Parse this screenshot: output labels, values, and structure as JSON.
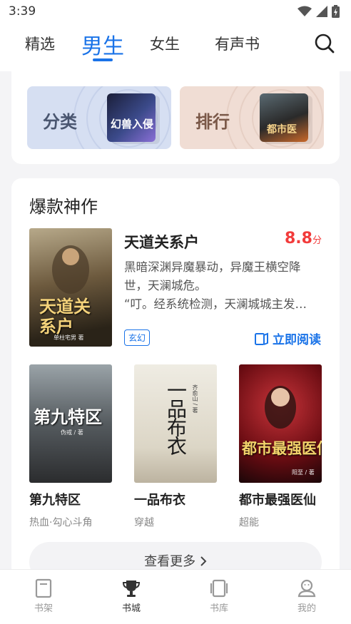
{
  "status": {
    "time": "3:39"
  },
  "nav": {
    "tabs": [
      {
        "label": "精选"
      },
      {
        "label": "男生"
      },
      {
        "label": "女生"
      },
      {
        "label": "有声书"
      }
    ]
  },
  "quick_entries": {
    "category_label": "分类",
    "category_cover_text": "幻兽入侵",
    "ranking_label": "排行",
    "ranking_cover_text": "都市医"
  },
  "featured": {
    "section_title": "爆款神作",
    "book": {
      "title": "天道关系户",
      "score": "8.8",
      "score_unit": "分",
      "desc_lines": [
        "黑暗深渊异魔暴动，异魔王横空降",
        "世，天澜城危。",
        "“叮。经系统检测，天澜城城主发…"
      ],
      "tag": "玄幻",
      "read_label": "立即阅读",
      "cover_title": "天道关系户",
      "cover_author": "单柱宅男 著"
    }
  },
  "books": [
    {
      "title": "第九特区",
      "tag": "热血·勾心斗角",
      "cover_title": "第九特区",
      "cover_author": "伪戒 / 著"
    },
    {
      "title": "一品布衣",
      "tag": "穿越",
      "cover_title": "一品布衣",
      "cover_author": "齐俞山 / 著"
    },
    {
      "title": "都市最强医仙",
      "tag": "超能",
      "cover_title": "都市最强医仙",
      "cover_author": "阳至 / 著"
    }
  ],
  "more_label": "查看更多",
  "bottom_nav": [
    {
      "label": "书架"
    },
    {
      "label": "书城"
    },
    {
      "label": "书库"
    },
    {
      "label": "我的"
    }
  ],
  "colors": {
    "accent": "#1a73e8",
    "score": "#f23b3b",
    "category_bg": "#d6dff2",
    "ranking_bg": "#f0ddd4"
  }
}
